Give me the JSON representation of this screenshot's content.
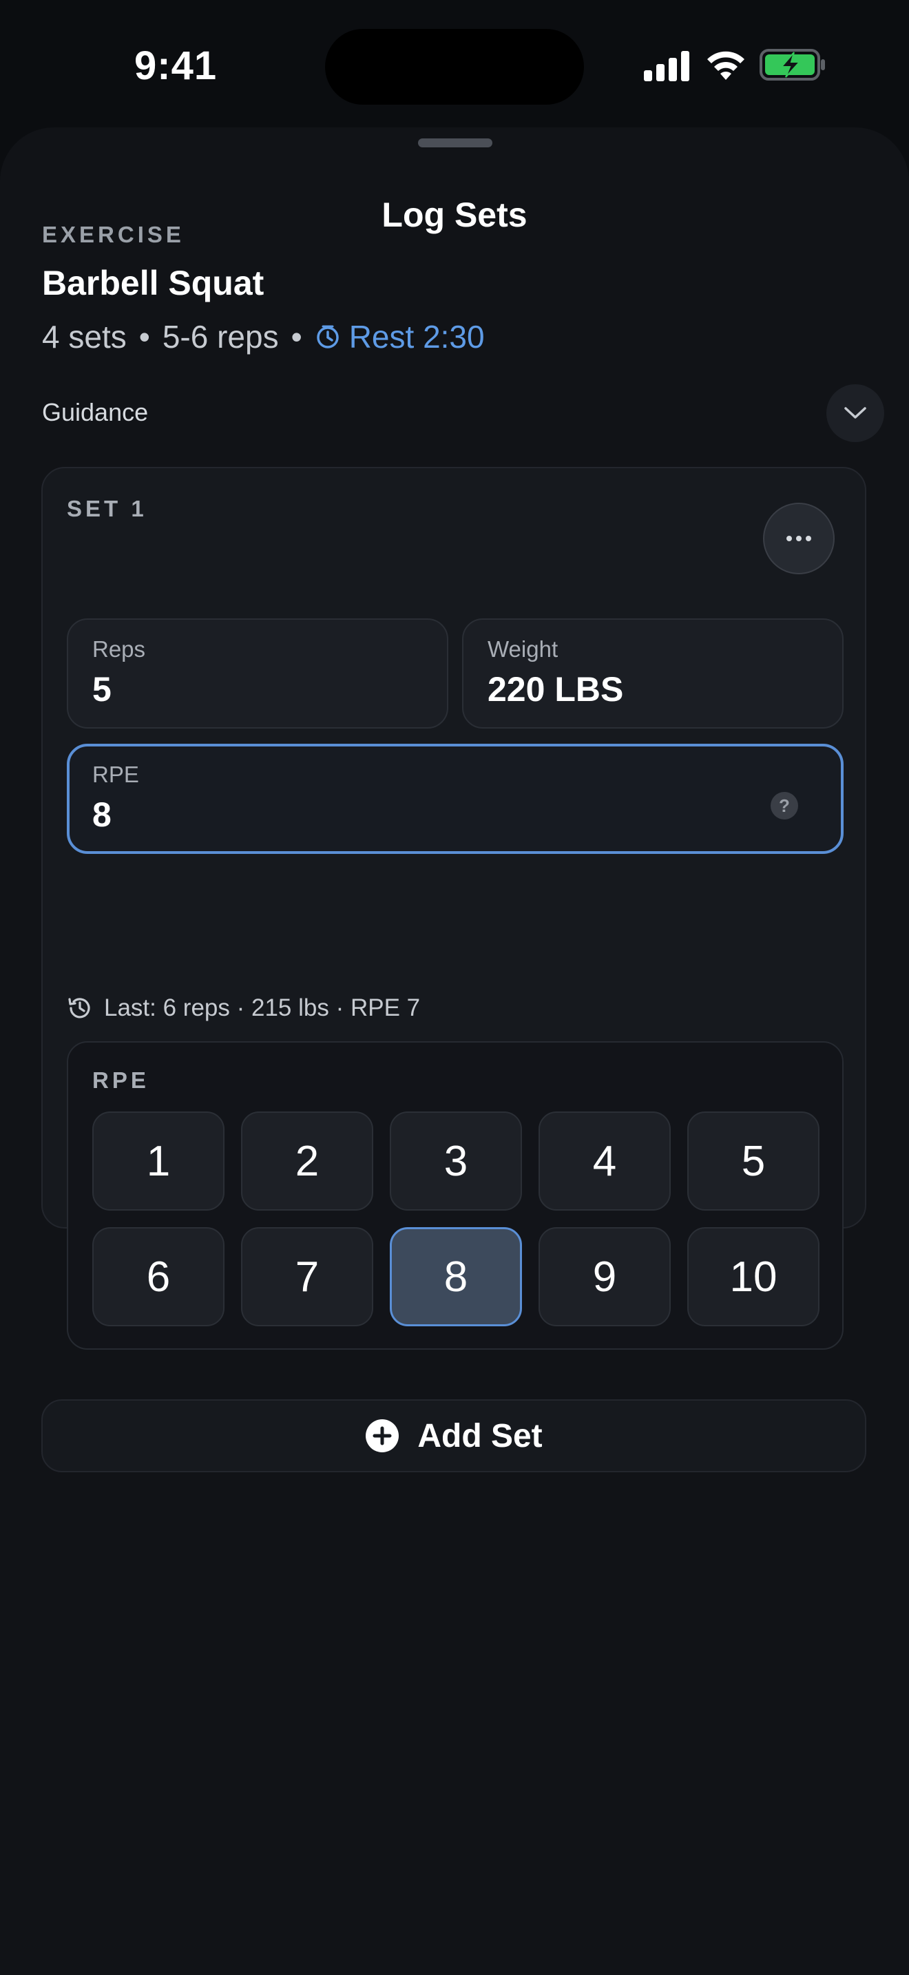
{
  "status_bar": {
    "time": "9:41"
  },
  "sheet": {
    "title": "Log Sets"
  },
  "exercise": {
    "eyebrow": "EXERCISE",
    "name": "Barbell Squat",
    "sets": "4 sets",
    "reps": "5-6 reps",
    "rest": "Rest 2:30",
    "separator": "•"
  },
  "guidance": {
    "label": "Guidance"
  },
  "set_card": {
    "label": "SET 1",
    "reps": {
      "label": "Reps",
      "value": "5"
    },
    "weight": {
      "label": "Weight",
      "value": "220 LBS"
    },
    "rpe": {
      "label": "RPE",
      "value": "8",
      "help": "?"
    },
    "last": "Last: 6 reps · 215 lbs · RPE 7",
    "rpe_picker": {
      "title": "RPE",
      "options": [
        "1",
        "2",
        "3",
        "4",
        "5",
        "6",
        "7",
        "8",
        "9",
        "10"
      ],
      "selected": "8"
    }
  },
  "add_set": {
    "label": "Add Set"
  },
  "colors": {
    "accent": "#5a8fd6",
    "rest_link": "#5e9be6",
    "battery": "#34c759"
  },
  "icons": [
    "signal-icon",
    "wifi-icon",
    "battery-charging-icon",
    "timer-icon",
    "chevron-down-icon",
    "more-icon",
    "help-icon",
    "history-icon",
    "plus-circle-icon"
  ]
}
